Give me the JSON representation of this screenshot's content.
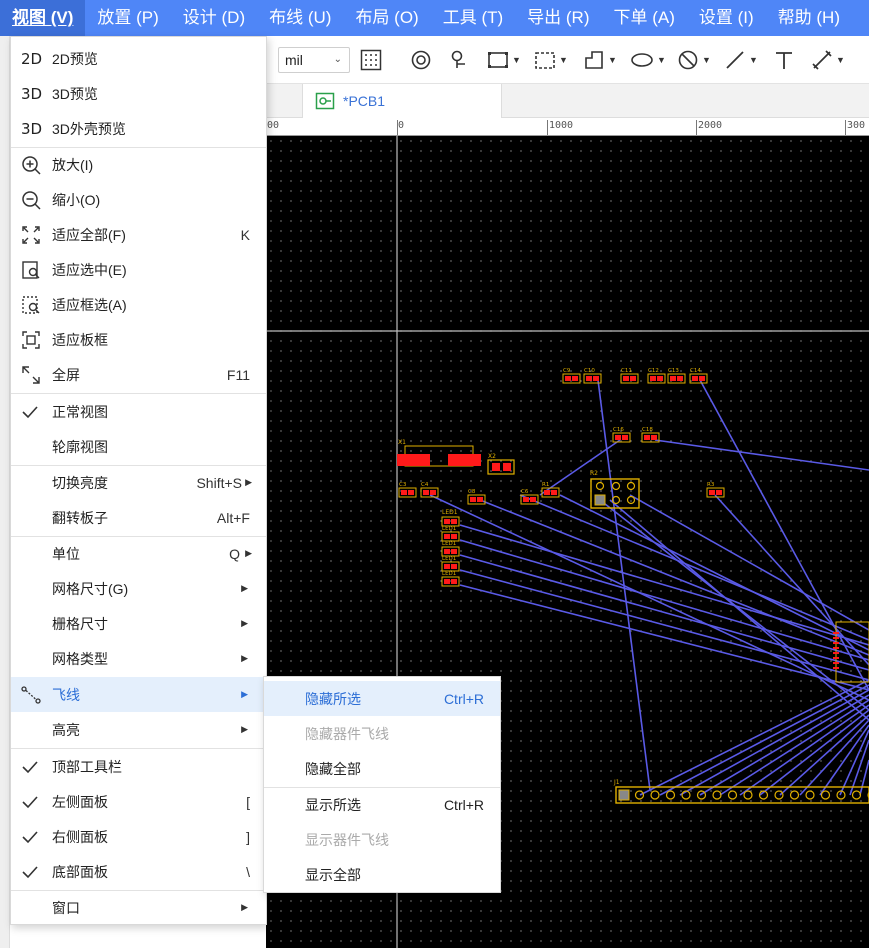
{
  "menubar": [
    {
      "label": "视图 (V)",
      "active": true
    },
    {
      "label": "放置 (P)"
    },
    {
      "label": "设计 (D)"
    },
    {
      "label": "布线 (U)"
    },
    {
      "label": "布局 (O)"
    },
    {
      "label": "工具 (T)"
    },
    {
      "label": "导出 (R)"
    },
    {
      "label": "下单 (A)"
    },
    {
      "label": "设置 (I)"
    },
    {
      "label": "帮助 (H)"
    }
  ],
  "toolbar": {
    "unit_value": "mil"
  },
  "tab": {
    "label": "*PCB1"
  },
  "ruler": {
    "labels": [
      "00",
      "0",
      "1000",
      "2000",
      "300"
    ]
  },
  "view_menu": {
    "items": [
      {
        "icon": "2D",
        "label": "2D预览"
      },
      {
        "icon": "3D",
        "label": "3D预览"
      },
      {
        "icon": "3D",
        "label": "3D外壳预览"
      },
      {
        "label": "放大(I)"
      },
      {
        "label": "缩小(O)"
      },
      {
        "label": "适应全部(F)",
        "shortcut": "K"
      },
      {
        "label": "适应选中(E)"
      },
      {
        "label": "适应框选(A)"
      },
      {
        "label": "适应板框"
      },
      {
        "label": "全屏",
        "shortcut": "F11"
      },
      {
        "label": "正常视图",
        "checked": true
      },
      {
        "label": "轮廓视图"
      },
      {
        "label": "切换亮度",
        "shortcut": "Shift+S"
      },
      {
        "label": "翻转板子",
        "shortcut": "Alt+F"
      },
      {
        "label": "单位",
        "shortcut": "Q"
      },
      {
        "label": "网格尺寸(G)"
      },
      {
        "label": "栅格尺寸"
      },
      {
        "label": "网格类型"
      },
      {
        "label": "飞线",
        "highlighted": true
      },
      {
        "label": "高亮"
      },
      {
        "label": "顶部工具栏",
        "checked": true
      },
      {
        "label": "左侧面板",
        "checked": true,
        "shortcut": "["
      },
      {
        "label": "右侧面板",
        "checked": true,
        "shortcut": "]"
      },
      {
        "label": "底部面板",
        "checked": true,
        "shortcut": "\\"
      },
      {
        "label": "窗口"
      }
    ]
  },
  "ratsnest_submenu": {
    "items": [
      {
        "label": "隐藏所选",
        "shortcut": "Ctrl+R",
        "highlighted": true
      },
      {
        "label": "隐藏器件飞线",
        "disabled": true
      },
      {
        "label": "隐藏全部"
      },
      {
        "label": "显示所选",
        "shortcut": "Ctrl+R"
      },
      {
        "label": "显示器件飞线",
        "disabled": true
      },
      {
        "label": "显示全部"
      }
    ]
  },
  "pcb": {
    "designators": [
      "C9",
      "C10",
      "C11",
      "C12",
      "C13",
      "C14",
      "C16",
      "C18",
      "X1",
      "X2",
      "C3",
      "C4",
      "C8",
      "C6",
      "C5",
      "R1",
      "R2",
      "R3",
      "LED1",
      "J1"
    ],
    "colors": {
      "ratsnest": "#5a5ae6",
      "pad": "#e0b000",
      "smd": "#ff1a1a",
      "silk": "#e0b000",
      "menu_accent": "#2c6ed6",
      "menubar": "#4f86f7"
    }
  }
}
